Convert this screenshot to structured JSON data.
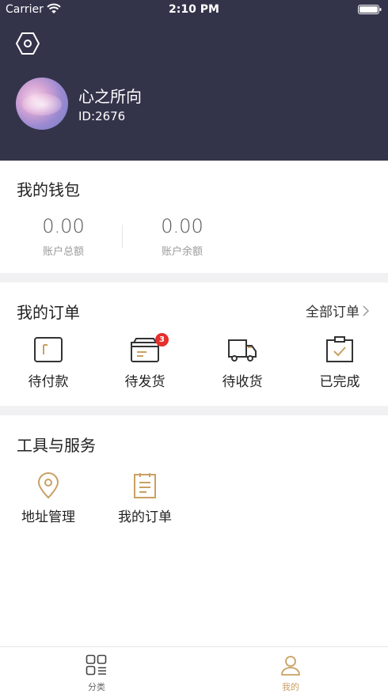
{
  "status_bar": {
    "carrier": "Carrier",
    "time": "2:10 PM"
  },
  "profile": {
    "name": "心之所向",
    "id_text": "ID:2676",
    "settings_icon": "hexagon-settings-icon"
  },
  "wallet": {
    "title": "我的钱包",
    "items": [
      {
        "amount": "0.00",
        "label": "账户总额"
      },
      {
        "amount": "0.00",
        "label": "账户余额"
      }
    ]
  },
  "orders": {
    "title": "我的订单",
    "all_link": "全部订单",
    "items": [
      {
        "label": "待付款",
        "icon": "wallet-icon"
      },
      {
        "label": "待发货",
        "icon": "box-icon",
        "badge": "3"
      },
      {
        "label": "待收货",
        "icon": "truck-icon"
      },
      {
        "label": "已完成",
        "icon": "completed-icon"
      }
    ]
  },
  "tools": {
    "title": "工具与服务",
    "items": [
      {
        "label": "地址管理",
        "icon": "location-icon"
      },
      {
        "label": "我的订单",
        "icon": "order-list-icon"
      }
    ]
  },
  "tabbar": {
    "items": [
      {
        "label": "分类",
        "icon": "category-grid-icon",
        "active": false
      },
      {
        "label": "我的",
        "icon": "user-icon",
        "active": true
      }
    ]
  },
  "colors": {
    "header_bg": "#33344a",
    "accent": "#c9a063",
    "badge": "#e5302d",
    "section_gap": "#f1f1f3"
  }
}
